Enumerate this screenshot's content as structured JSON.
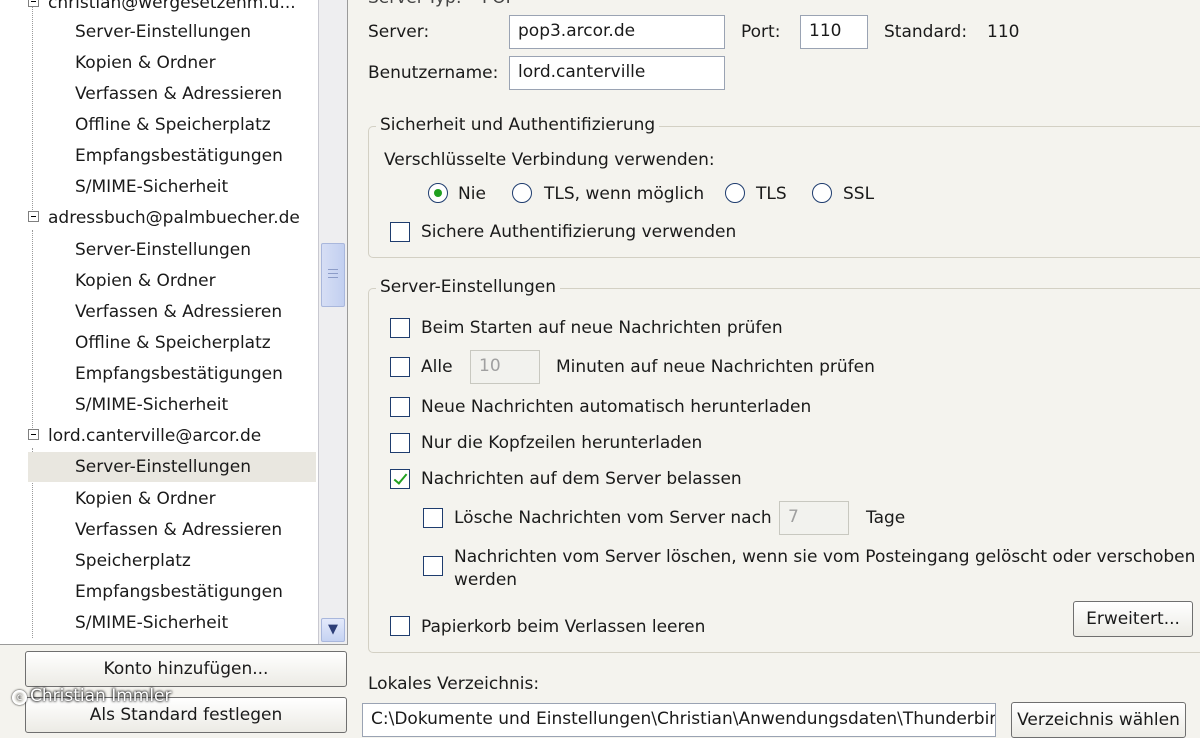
{
  "tree": {
    "top_account_label": "christian@wergesetzenm.u...",
    "accounts": [
      {
        "label": "adressbuch@palmbuecher.de",
        "items": [
          "Server-Einstellungen",
          "Kopien & Ordner",
          "Verfassen & Adressieren",
          "Offline & Speicherplatz",
          "Empfangsbestätigungen",
          "S/MIME-Sicherheit"
        ]
      },
      {
        "label": "lord.canterville@arcor.de",
        "items": [
          "Server-Einstellungen",
          "Kopien & Ordner",
          "Verfassen & Adressieren",
          "Speicherplatz",
          "Empfangsbestätigungen",
          "S/MIME-Sicherheit"
        ]
      }
    ],
    "top_items": [
      "Server-Einstellungen",
      "Kopien & Ordner",
      "Verfassen & Adressieren",
      "Offline & Speicherplatz",
      "Empfangsbestätigungen",
      "S/MIME-Sicherheit"
    ],
    "selected_item": "Server-Einstellungen"
  },
  "buttons": {
    "add_account": "Konto hinzufügen...",
    "set_default": "Als Standard festlegen",
    "advanced": "Erweitert...",
    "choose_folder": "Verzeichnis wählen"
  },
  "server": {
    "type_label": "Server-Typ:",
    "type_value": "POP",
    "server_label": "Server:",
    "server_value": "pop3.arcor.de",
    "port_label": "Port:",
    "port_value": "110",
    "standard_label": "Standard:",
    "standard_value": "110",
    "username_label": "Benutzername:",
    "username_value": "lord.canterville"
  },
  "security": {
    "title": "Sicherheit und Authentifizierung",
    "encryption_label": "Verschlüsselte Verbindung verwenden:",
    "options": [
      "Nie",
      "TLS, wenn möglich",
      "TLS",
      "SSL"
    ],
    "selected_option": "Nie",
    "secure_auth_label": "Sichere Authentifizierung verwenden",
    "secure_auth_checked": false
  },
  "server_settings": {
    "title": "Server-Einstellungen",
    "check_on_start": "Beim Starten auf neue Nachrichten prüfen",
    "check_every_prefix": "Alle",
    "check_every_minutes": "10",
    "check_every_suffix": "Minuten auf neue Nachrichten prüfen",
    "auto_download": "Neue Nachrichten automatisch herunterladen",
    "headers_only": "Nur die Kopfzeilen herunterladen",
    "leave_on_server": "Nachrichten auf dem Server belassen",
    "leave_on_server_checked": true,
    "delete_after_prefix": "Lösche Nachrichten vom Server nach",
    "delete_after_days": "7",
    "delete_after_suffix": "Tage",
    "delete_when_removed_line1": "Nachrichten vom Server löschen, wenn sie vom Posteingang gelöscht oder verschoben",
    "delete_when_removed_line2": "werden",
    "empty_trash": "Papierkorb beim Verlassen leeren"
  },
  "local_folder": {
    "label": "Lokales Verzeichnis:",
    "path": "C:\\Dokumente und Einstellungen\\Christian\\Anwendungsdaten\\Thunderbird"
  },
  "watermark": "Christian Immler",
  "colors": {
    "check_green": "#21a121",
    "control_border": "#1e3c6e",
    "panel_bg": "#f4f3ee"
  }
}
